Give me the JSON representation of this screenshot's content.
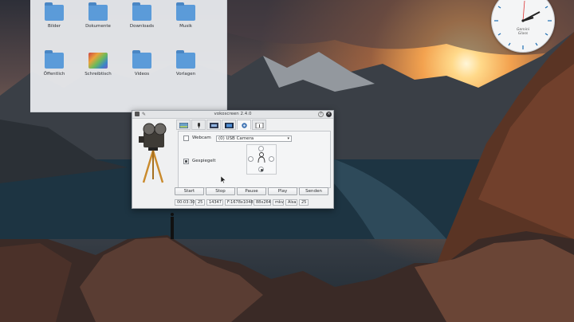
{
  "colors": {
    "folder": "#5b9bd9",
    "window_bg": "#eff0f1",
    "close_button": "#2f2f33"
  },
  "file_manager": {
    "items": [
      {
        "label": "Bilder",
        "icon": "folder-icon"
      },
      {
        "label": "Dokumente",
        "icon": "folder-icon"
      },
      {
        "label": "Downloads",
        "icon": "folder-icon"
      },
      {
        "label": "Musik",
        "icon": "folder-icon"
      },
      {
        "label": "Öffentlich",
        "icon": "folder-icon"
      },
      {
        "label": "Schreibtisch",
        "icon": "desktop-folder-icon"
      },
      {
        "label": "Videos",
        "icon": "folder-icon"
      },
      {
        "label": "Vorlagen",
        "icon": "folder-icon"
      }
    ]
  },
  "clock": {
    "brand_line1": "Gemini",
    "brand_line2": "Glass"
  },
  "vokoscreen": {
    "title": "vokoscreen 2.4.0",
    "help_icon": "?",
    "close_icon": "×",
    "tabs": [
      {
        "icon": "screen-icon"
      },
      {
        "icon": "microphone-icon"
      },
      {
        "icon": "video-settings-icon"
      },
      {
        "icon": "film-icon"
      },
      {
        "icon": "webcam-icon",
        "active": true
      },
      {
        "icon": "info-icon"
      }
    ],
    "webcam_label": "Webcam",
    "webcam_checked": false,
    "camera_select": "(0) USB Camera",
    "mirrored_label": "Gespiegelt",
    "mirrored_checked": true,
    "buttons": [
      "Start",
      "Stop",
      "Pause",
      "Play",
      "Senden"
    ],
    "status": [
      "00:03:30",
      "25",
      "14347",
      "F:1678x1048",
      "88x264",
      "mkv",
      "Alsa",
      "25"
    ]
  }
}
